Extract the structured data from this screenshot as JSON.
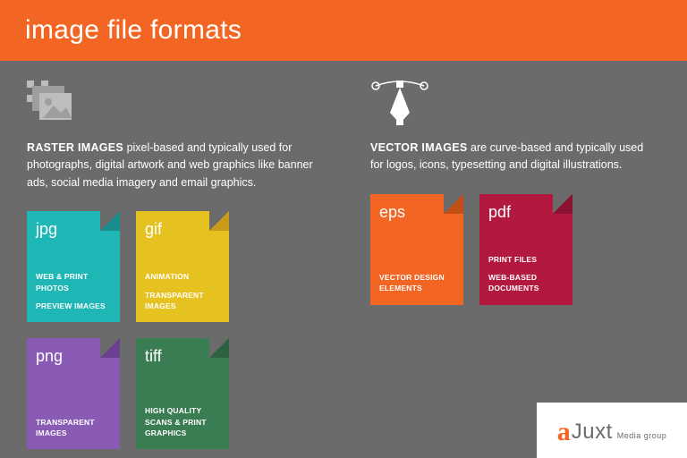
{
  "header": {
    "title": "image file formats"
  },
  "raster": {
    "heading": "RASTER IMAGES",
    "body": "pixel-based and typically used for photographs, digital artwork and web graphics like banner ads, social media imagery and email graphics.",
    "formats": [
      {
        "ext": "jpg",
        "class": "jpg",
        "use1": "WEB & PRINT PHOTOS",
        "use2": "PREVIEW IMAGES"
      },
      {
        "ext": "gif",
        "class": "gif",
        "use1": "ANIMATION",
        "use2": "TRANSPARENT IMAGES"
      },
      {
        "ext": "png",
        "class": "png",
        "use1": "TRANSPARENT IMAGES",
        "use2": ""
      },
      {
        "ext": "tiff",
        "class": "tiff",
        "use1": "HIGH QUALITY SCANS & PRINT GRAPHICS",
        "use2": ""
      }
    ]
  },
  "vector": {
    "heading": "VECTOR IMAGES",
    "body": "are curve-based and typically used for logos, icons, typesetting and digital illustrations.",
    "formats": [
      {
        "ext": "eps",
        "class": "eps",
        "use1": "VECTOR DESIGN ELEMENTS",
        "use2": ""
      },
      {
        "ext": "pdf",
        "class": "pdf",
        "use1": "PRINT FILES",
        "use2": "WEB-BASED DOCUMENTS"
      }
    ]
  },
  "logo": {
    "mark": "a",
    "name": "Juxt",
    "sub": "Media group"
  }
}
